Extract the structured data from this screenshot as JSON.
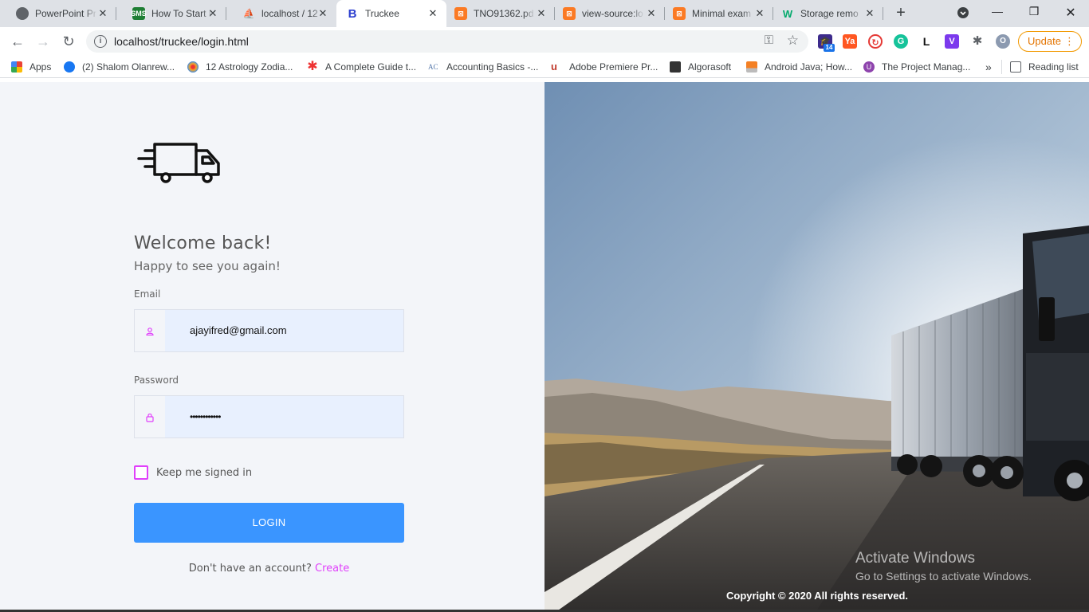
{
  "browser": {
    "tabs": [
      {
        "title": "PowerPoint Pr",
        "icon": "github-icon",
        "color": "#555555"
      },
      {
        "title": "How To Start I",
        "icon": "sms-icon",
        "color": "#1e7e34"
      },
      {
        "title": "localhost / 12",
        "icon": "phpmyadmin-icon",
        "color": "#f0a030"
      },
      {
        "title": "Truckee",
        "icon": "bootstrap-icon",
        "color": "#2b3ecf"
      },
      {
        "title": "TNO91362.pd",
        "icon": "xampp-icon",
        "color": "#fb7a24"
      },
      {
        "title": "view-source:lo",
        "icon": "xampp-icon",
        "color": "#fb7a24"
      },
      {
        "title": "Minimal exam",
        "icon": "xampp-icon",
        "color": "#fb7a24"
      },
      {
        "title": "Storage remo",
        "icon": "w3schools-icon",
        "color": "#04aa6d"
      }
    ],
    "url": "localhost/truckee/login.html",
    "update_label": "Update",
    "ext_badge": "14",
    "bookmarks": [
      {
        "label": "Apps",
        "icon": "apps-grid-icon",
        "color": "#e44"
      },
      {
        "label": "(2) Shalom Olanrew...",
        "icon": "facebook-icon",
        "color": "#1877f2"
      },
      {
        "label": "12 Astrology Zodia...",
        "icon": "astrology-icon",
        "color": "#c33"
      },
      {
        "label": "A Complete Guide t...",
        "icon": "asterisk-icon",
        "color": "#e33"
      },
      {
        "label": "Accounting Basics -...",
        "icon": "ac-icon",
        "color": "#5577aa"
      },
      {
        "label": "Adobe Premiere Pr...",
        "icon": "udemy-icon",
        "color": "#c0392b"
      },
      {
        "label": "Algorasoft",
        "icon": "algorasoft-icon",
        "color": "#333333"
      },
      {
        "label": "Android Java; How...",
        "icon": "stackoverflow-icon",
        "color": "#f48024"
      },
      {
        "label": "The Project Manag...",
        "icon": "u-icon",
        "color": "#8e44ad"
      }
    ],
    "more_label": "»",
    "reading_list": "Reading list"
  },
  "login": {
    "welcome": "Welcome back!",
    "subtitle": "Happy to see you again!",
    "email_label": "Email",
    "email_value": "ajayifred@gmail.com",
    "password_label": "Password",
    "password_value": "••••••••••••",
    "remember_label": "Keep me signed in",
    "login_button": "LOGIN",
    "signup_text": "Don't have an account?",
    "signup_link": "Create"
  },
  "hero": {
    "copyright": "Copyright © 2020 All rights reserved."
  },
  "os": {
    "activate_title": "Activate Windows",
    "activate_sub": "Go to Settings to activate Windows."
  },
  "colors": {
    "accent": "#3a95ff",
    "link": "#e040fb",
    "panel_bg": "#f3f5f9",
    "input_bg": "#e8f0fe"
  }
}
